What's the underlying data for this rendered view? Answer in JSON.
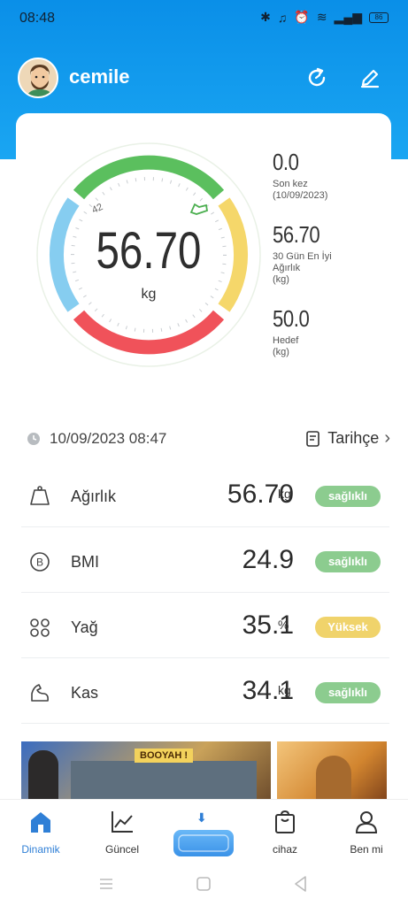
{
  "status_bar": {
    "time": "08:48",
    "battery": "86"
  },
  "header": {
    "username": "cemile"
  },
  "gauge": {
    "value": "56.70",
    "unit": "kg",
    "min_label": "42"
  },
  "stats": [
    {
      "value": "0.0",
      "label_lines": [
        "Son kez",
        "(10/09/2023)"
      ]
    },
    {
      "value": "56.70",
      "label_lines": [
        "30 Gün En İyi",
        "Ağırlık",
        "(kg)"
      ]
    },
    {
      "value": "50.0",
      "label_lines": [
        "Hedef",
        "(kg)"
      ]
    }
  ],
  "date_row": {
    "datetime": "10/09/2023 08:47",
    "history_label": "Tarihçe"
  },
  "metrics": [
    {
      "name": "Ağırlık",
      "value": "56.70",
      "unit": "kg",
      "status": "sağlıklı",
      "status_color": "#8ccc8f",
      "icon": "weight-icon"
    },
    {
      "name": "BMI",
      "value": "24.9",
      "unit": "",
      "status": "sağlıklı",
      "status_color": "#8ccc8f",
      "icon": "bmi-icon"
    },
    {
      "name": "Yağ",
      "value": "35.1",
      "unit": "%",
      "status": "Yüksek",
      "status_color": "#f0d36b",
      "icon": "fat-icon"
    },
    {
      "name": "Kas",
      "value": "34.1",
      "unit": "kg",
      "status": "sağlıklı",
      "status_color": "#8ccc8f",
      "icon": "muscle-icon"
    }
  ],
  "banner": {
    "text": "BOOYAH !"
  },
  "tabs": [
    {
      "label": "Dinamik",
      "active": true,
      "icon": "home-icon"
    },
    {
      "label": "Güncel",
      "active": false,
      "icon": "trend-icon"
    },
    {
      "label": "",
      "active": false,
      "icon": "scale-icon"
    },
    {
      "label": "cihaz",
      "active": false,
      "icon": "bag-icon"
    },
    {
      "label": "Ben mi",
      "active": false,
      "icon": "person-icon"
    }
  ],
  "colors": {
    "accent": "#2f7fd6",
    "header_bg": "#1aa6f2",
    "healthy": "#8ccc8f",
    "high": "#f0d36b"
  }
}
